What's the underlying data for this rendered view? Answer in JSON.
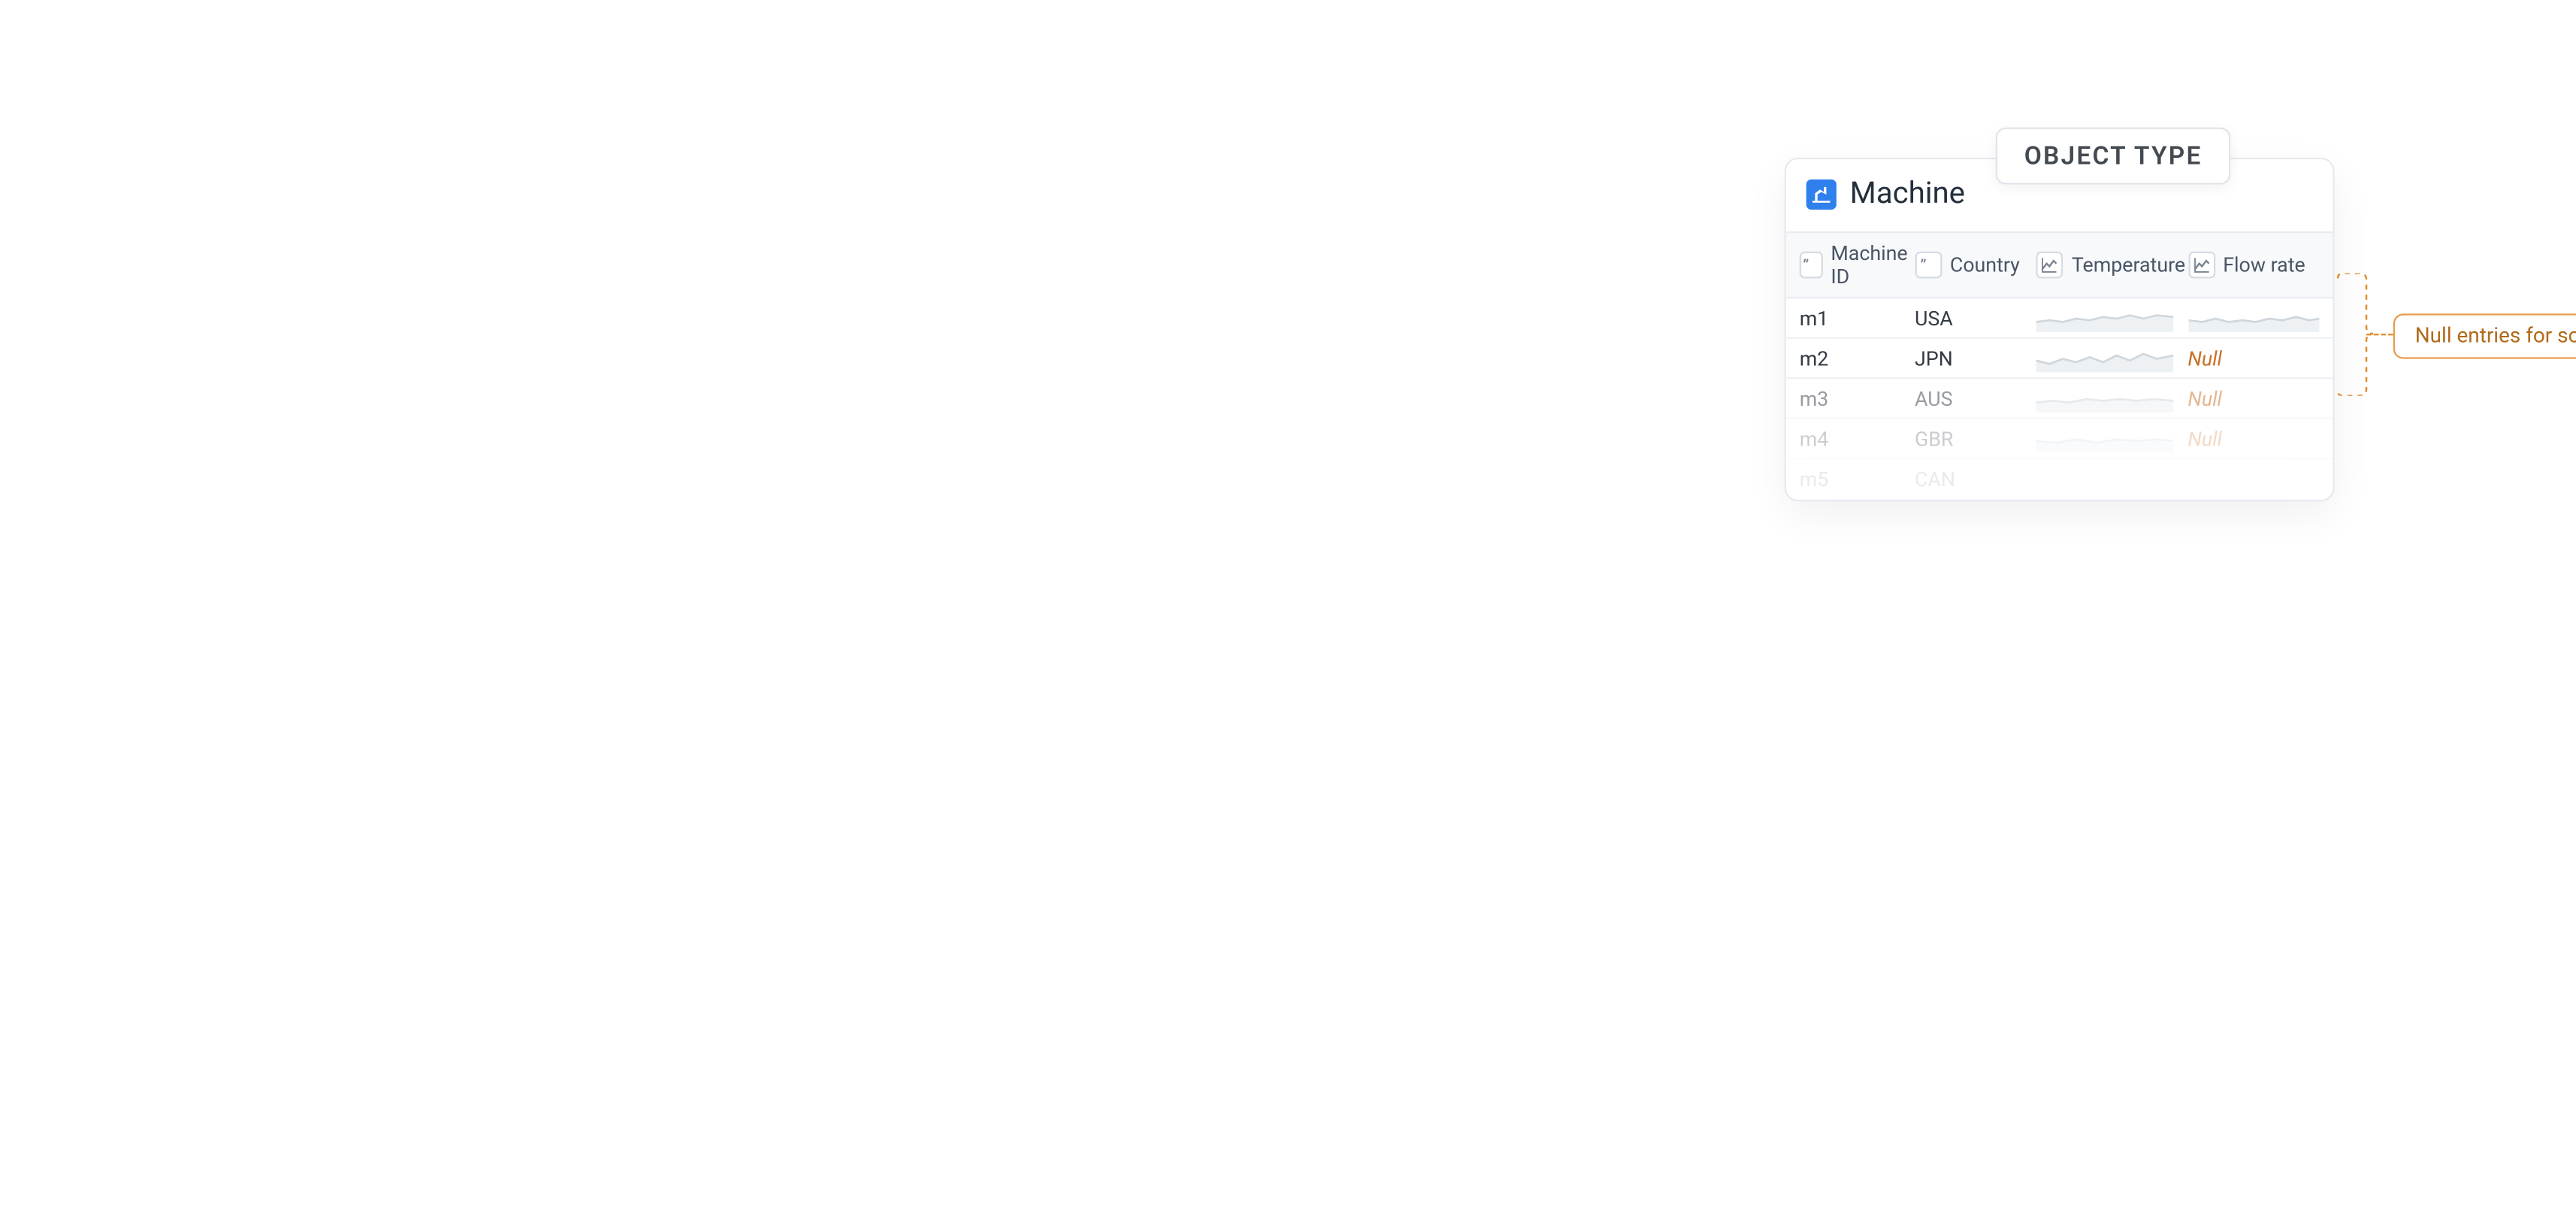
{
  "badge": {
    "label": "OBJECT TYPE"
  },
  "card": {
    "title": "Machine",
    "columns": [
      {
        "label": "Machine ID",
        "type": "string"
      },
      {
        "label": "Country",
        "type": "string"
      },
      {
        "label": "Temperature",
        "type": "timeseries"
      },
      {
        "label": "Flow rate",
        "type": "timeseries"
      }
    ],
    "rows": [
      {
        "id": "m1",
        "country": "USA",
        "temp": "spark",
        "flow": "spark"
      },
      {
        "id": "m2",
        "country": "JPN",
        "temp": "spark",
        "flow": "Null"
      },
      {
        "id": "m3",
        "country": "AUS",
        "temp": "spark",
        "flow": "Null"
      },
      {
        "id": "m4",
        "country": "GBR",
        "temp": "spark",
        "flow": "Null"
      },
      {
        "id": "m5",
        "country": "CAN",
        "temp": "",
        "flow": ""
      }
    ]
  },
  "callout": {
    "text": "Null entries for some objects"
  },
  "colors": {
    "accent_blue": "#2f80ed",
    "warn_orange": "#c87026",
    "border_orange": "#e89b4a"
  }
}
